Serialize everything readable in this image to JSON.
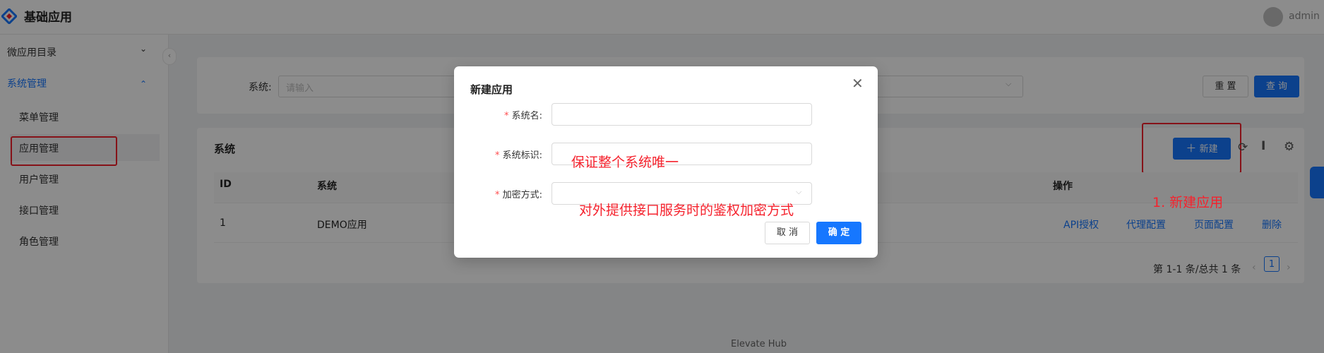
{
  "header": {
    "title": "基础应用",
    "user": "admin"
  },
  "sidebar": {
    "groups": [
      {
        "label": "微应用目录",
        "chevron": "⌄"
      },
      {
        "label": "系统管理",
        "chevron": "⌃"
      }
    ],
    "items": [
      "菜单管理",
      "应用管理",
      "用户管理",
      "接口管理",
      "角色管理"
    ],
    "collapse_icon": "‹"
  },
  "search": {
    "label": "系统:",
    "placeholder": "请输入",
    "reset_label": "重 置",
    "query_label": "查 询"
  },
  "table_card": {
    "title": "系统",
    "new_label": "新建",
    "columns": [
      "ID",
      "系统",
      "操作"
    ],
    "rows": [
      {
        "id": "1",
        "name": "DEMO应用",
        "actions": [
          "API授权",
          "代理配置",
          "页面配置",
          "删除"
        ]
      }
    ],
    "pagination": {
      "summary": "第 1-1 条/总共 1 条",
      "page": "1"
    }
  },
  "footer": {
    "text": "Elevate Hub"
  },
  "modal": {
    "title": "新建应用",
    "fields": [
      {
        "label": "系统名:",
        "required": true
      },
      {
        "label": "系统标识:",
        "required": true
      },
      {
        "label": "加密方式:",
        "required": true
      }
    ],
    "cancel_label": "取 消",
    "ok_label": "确 定"
  },
  "annotations": {
    "identifier_note": "保证整个系统唯一",
    "encryption_note": "对外提供接口服务时的鉴权加密方式",
    "step_note": "1. 新建应用"
  },
  "colors": {
    "primary": "#1677ff",
    "annotation_red": "#f5222d"
  }
}
